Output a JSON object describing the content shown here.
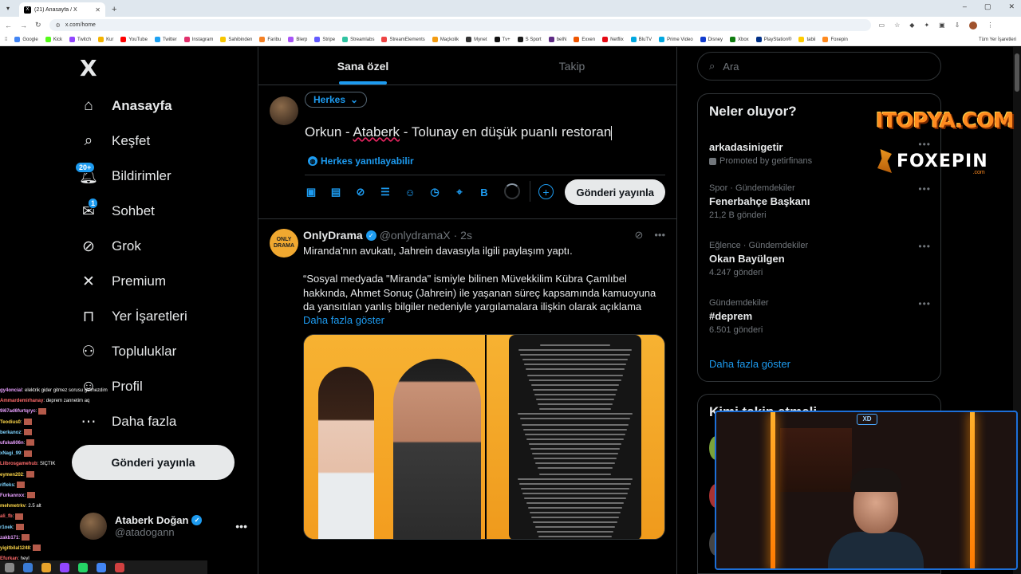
{
  "browser": {
    "tab_title": "(21) Anasayfa / X",
    "url": "x.com/home",
    "bookmarks": [
      "Google",
      "Kick",
      "Twitch",
      "Kur",
      "YouTube",
      "Twitter",
      "Instagram",
      "Sahibinden",
      "Faribu",
      "Blerp",
      "Stripe",
      "Streamlabs",
      "StreamElements",
      "Maçkolik",
      "Mynet",
      "Tv+",
      "S Sport",
      "beIN",
      "Exxen",
      "Netflix",
      "BluTV",
      "Prime Video",
      "Disney",
      "Xbox",
      "PlayStation®",
      "tabii",
      "Foxepin"
    ],
    "all_bookmarks": "Tüm Yer İşaretleri"
  },
  "sidebar": {
    "logo": "X",
    "items": [
      {
        "label": "Anasayfa",
        "icon": "home-icon"
      },
      {
        "label": "Keşfet",
        "icon": "search-icon"
      },
      {
        "label": "Bildirimler",
        "icon": "bell-icon",
        "badge": "20+"
      },
      {
        "label": "Sohbet",
        "icon": "mail-icon",
        "badge": "1"
      },
      {
        "label": "Grok",
        "icon": "grok-icon"
      },
      {
        "label": "Premium",
        "icon": "x-icon"
      },
      {
        "label": "Yer İşaretleri",
        "icon": "bookmark-icon"
      },
      {
        "label": "Topluluklar",
        "icon": "communities-icon"
      },
      {
        "label": "Profil",
        "icon": "profile-icon"
      },
      {
        "label": "Daha fazla",
        "icon": "more-circle-icon"
      }
    ],
    "post_button": "Gönderi yayınla",
    "account": {
      "name": "Ataberk Doğan",
      "handle": "@atadogann"
    }
  },
  "chat": [
    {
      "user": "gy4oncial",
      "msg": ": elektrik gider gitmez sorusu gelmezdim",
      "cls": "u1"
    },
    {
      "user": "Ammardemirhanay",
      "msg": ": deprem zannetim aq",
      "cls": "u2"
    },
    {
      "user": "9i67ad6furtqryc",
      "msg": ":",
      "cls": "u1"
    },
    {
      "user": "Teodius0",
      "msg": ":",
      "cls": "u4"
    },
    {
      "user": "berkanoz",
      "msg": ":",
      "cls": "u3"
    },
    {
      "user": "ufuka606n",
      "msg": ":",
      "cls": "u1"
    },
    {
      "user": "xNagi_99",
      "msg": ":",
      "cls": "u3"
    },
    {
      "user": "Lilbrosgamehub",
      "msg": ": SIÇTIK",
      "cls": "u2"
    },
    {
      "user": "eymen202",
      "msg": ":",
      "cls": "u4"
    },
    {
      "user": "rifleks",
      "msg": ":",
      "cls": "u3"
    },
    {
      "user": "Furkannxx",
      "msg": ":",
      "cls": "u1"
    },
    {
      "user": "mehmetrkv",
      "msg": ": 2.5 alt",
      "cls": "u4"
    },
    {
      "user": "ali_fb",
      "msg": ":",
      "cls": "u2"
    },
    {
      "user": "r1oek",
      "msg": ":",
      "cls": "u3"
    },
    {
      "user": "zakb171",
      "msg": ":",
      "cls": "u1"
    },
    {
      "user": "yigitbilal1248",
      "msg": ":",
      "cls": "u4"
    },
    {
      "user": "Efurkan",
      "msg": ": heyl",
      "cls": "u2"
    }
  ],
  "main": {
    "tabs": [
      "Sana özel",
      "Takip"
    ],
    "composer": {
      "audience": "Herkes",
      "text_before": "Orkun - ",
      "text_err": "Ataberk",
      "text_after": " - Tolunay en düşük puanlı restoran",
      "reply_setting": "Herkes yanıtlayabilir",
      "post_button": "Gönderi yayınla",
      "tools": [
        "media-icon",
        "gif-icon",
        "grok-icon",
        "poll-icon",
        "emoji-icon",
        "schedule-icon",
        "location-icon",
        "bold-icon"
      ]
    },
    "tweet": {
      "avatar_text": "ONLY DRAMA",
      "name": "OnlyDrama",
      "handle": "@onlydramaX",
      "time": "· 2s",
      "line1": "Miranda'nın avukatı, Jahrein davasıyla ilgili paylaşım yaptı.",
      "quote": "“Sosyal medyada \"Miranda\" ismiyle bilinen Müvekkilim Kübra Çamlıbel hakkında, Ahmet Sonuç (Jahrein) ile yaşanan süreç kapsamında kamuoyuna da yansıtılan yanlış bilgiler nedeniyle yargılamalara ilişkin olarak açıklama",
      "show_more": "Daha fazla göster"
    }
  },
  "right": {
    "search_placeholder": "Ara",
    "trends_title": "Neler oluyor?",
    "trends": [
      {
        "context": "",
        "title": "arkadasinigetir",
        "count": "Promoted by getirfinans",
        "promoted": true
      },
      {
        "context": "Spor · Gündemdekiler",
        "title": "Fenerbahçe Başkanı",
        "count": "21,2 B gönderi"
      },
      {
        "context": "Eğlence · Gündemdekiler",
        "title": "Okan Bayülgen",
        "count": "4.247 gönderi"
      },
      {
        "context": "Gündemdekiler",
        "title": "#deprem",
        "count": "6.501 gönderi"
      }
    ],
    "trends_more": "Daha fazla göster",
    "who_title": "Kimi takip etmeli"
  },
  "overlays": {
    "logo1": "ITOPYA.COM",
    "logo2": "FOXEPIN",
    "logo2_sub": ".com",
    "cam_logo": "XD"
  },
  "colors": {
    "accent": "#1d9bf0",
    "background": "#000000",
    "text": "#e7e9ea",
    "muted": "#71767b",
    "border": "#2f3336"
  }
}
